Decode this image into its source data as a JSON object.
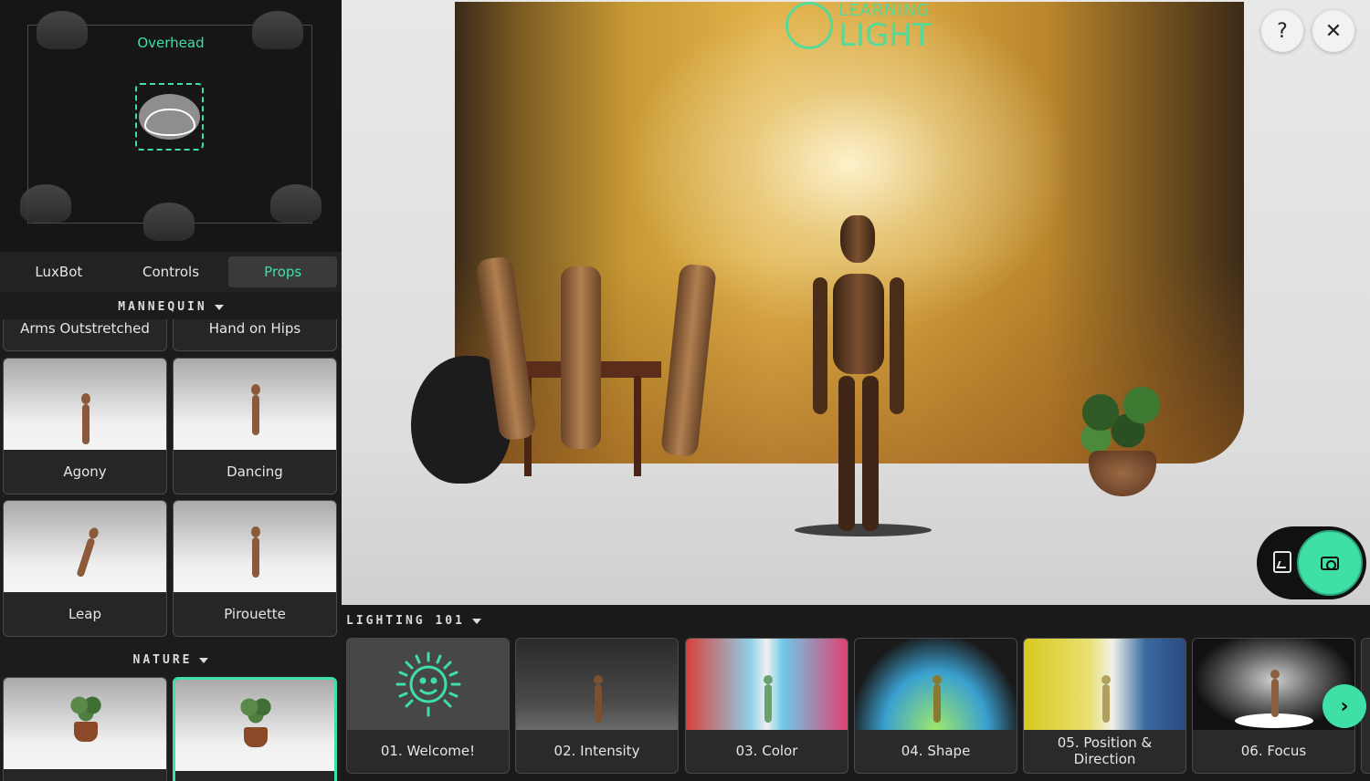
{
  "overhead": {
    "label": "Overhead"
  },
  "tabs": [
    {
      "label": "LuxBot",
      "active": false
    },
    {
      "label": "Controls",
      "active": false
    },
    {
      "label": "Props",
      "active": true
    }
  ],
  "props": {
    "mannequin_section": "MANNEQUIN",
    "partial_cards": [
      "Arms Outstretched",
      "Hand on Hips"
    ],
    "cards": [
      {
        "label": "Agony"
      },
      {
        "label": "Dancing"
      },
      {
        "label": "Leap"
      },
      {
        "label": "Pirouette"
      }
    ],
    "nature_section": "NATURE"
  },
  "scene": {
    "logo_line1": "LEARNING",
    "logo_line2": "LIGHT"
  },
  "toolbar": {
    "help_label": "?",
    "close_label": "✕"
  },
  "lessons": {
    "section": "LIGHTING 101",
    "items": [
      {
        "label": "01. Welcome!"
      },
      {
        "label": "02. Intensity"
      },
      {
        "label": "03. Color"
      },
      {
        "label": "04. Shape"
      },
      {
        "label": "05. Position & Direction"
      },
      {
        "label": "06. Focus"
      }
    ],
    "next_label": "›"
  },
  "colors": {
    "accent": "#3ee0a5",
    "panel": "#1c1c1c",
    "card_border": "#4a4a4a"
  },
  "icons": [
    "help-icon",
    "close-icon",
    "gallery-icon",
    "camera-icon",
    "chevron-right-icon",
    "caret-down-icon",
    "light-lamp-icon",
    "smiley-sun-icon"
  ]
}
